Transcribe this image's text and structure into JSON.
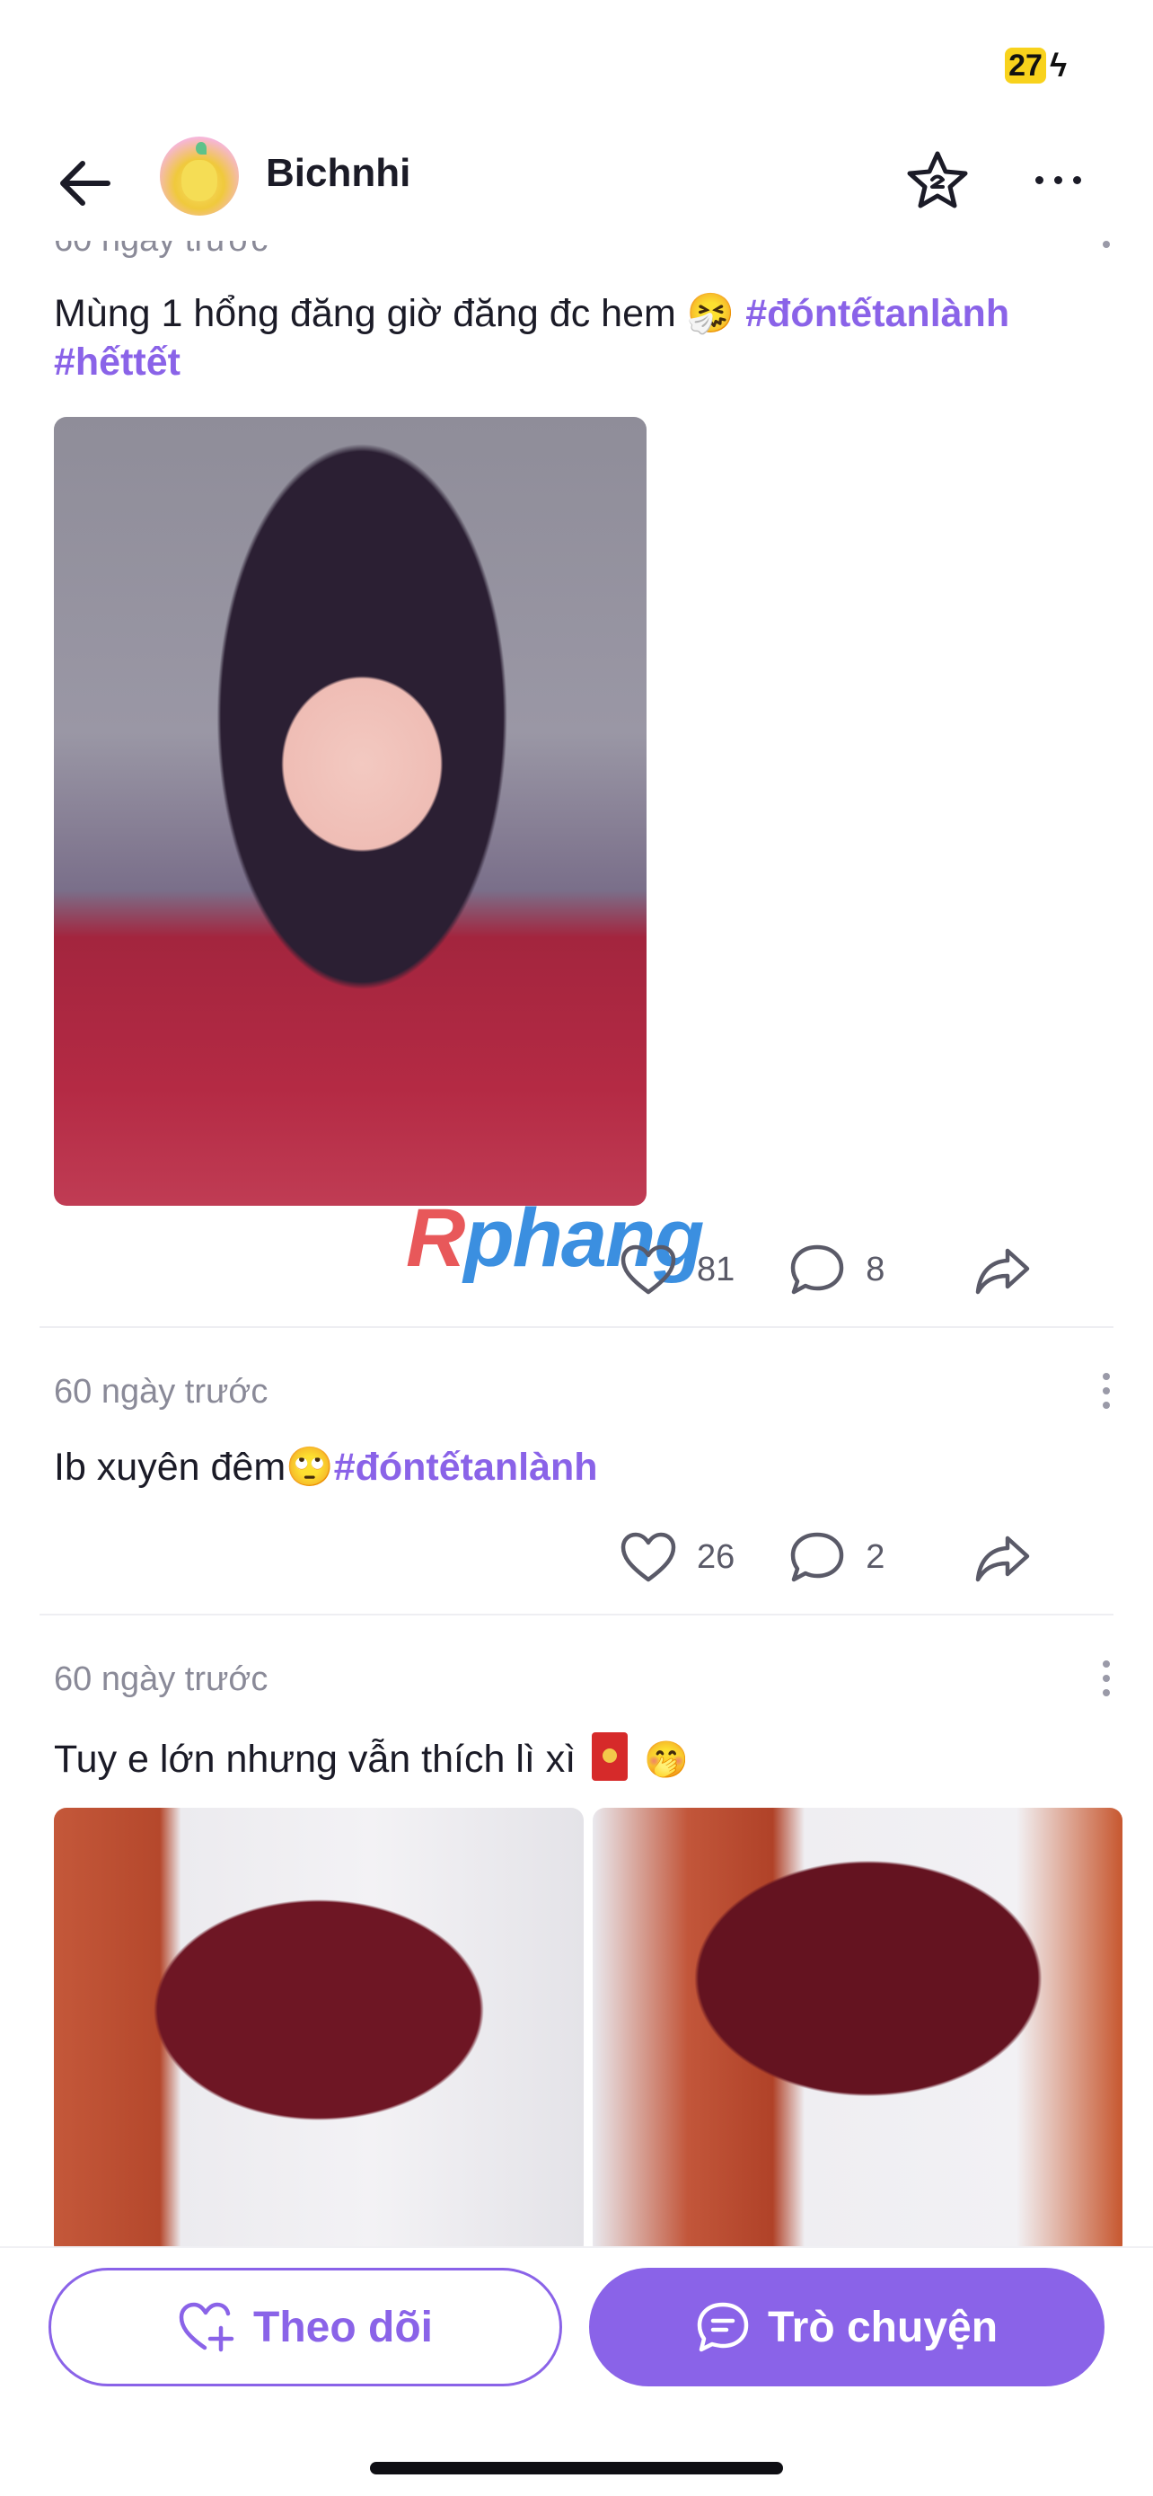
{
  "status_bar": {
    "battery": "27"
  },
  "header": {
    "username": "Bichnhi"
  },
  "cut_post": {
    "time": "60 ngày trước"
  },
  "posts": [
    {
      "text": "Mùng 1 hổng đăng giờ đăng đc hem 🤧",
      "hashtags": [
        "#đóntếtanlành",
        "#hếttết"
      ],
      "likes": "81",
      "comments": "8"
    },
    {
      "time": "60 ngày trước",
      "text": "Ib xuyên đêm🙄",
      "hashtags": [
        "#đóntếtanlành"
      ],
      "likes": "26",
      "comments": "2"
    },
    {
      "time": "60 ngày trước",
      "text": "Tuy e lớn nhưng vẫn thích lì xì",
      "emoji_after": "🤭"
    }
  ],
  "watermark": {
    "r": "R",
    "rest": "phang"
  },
  "bottom_bar": {
    "follow_label": "Theo dõi",
    "chat_label": "Trò chuyện"
  },
  "colors": {
    "accent": "#8a63e8",
    "text": "#1b1b27",
    "muted": "#8a8a98"
  },
  "icons": [
    "back-arrow-icon",
    "star-icon",
    "more-icon",
    "heart-icon",
    "comment-icon",
    "share-icon",
    "heart-plus-icon",
    "chat-icon"
  ]
}
